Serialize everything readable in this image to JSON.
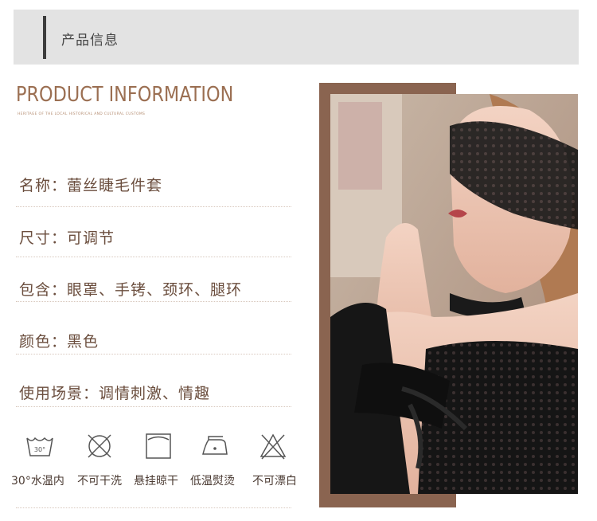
{
  "header": {
    "title": "产品信息"
  },
  "intro": {
    "title_en": "PRODUCT INFORMATION",
    "subtitle_en": "HERITAGE OF THE LOCAL HISTORICAL AND CULTURAL CUSTOMS"
  },
  "specs": [
    {
      "text": "名称：蕾丝睫毛件套"
    },
    {
      "text": "尺寸：可调节"
    },
    {
      "text": "包含：眼罩、手铐、颈环、腿环"
    },
    {
      "text": "颜色：黑色"
    },
    {
      "text": "使用场景：调情刺激、情趣"
    }
  ],
  "care": [
    {
      "icon": "wash-30-icon",
      "label": "30°水温内",
      "badge": "30°"
    },
    {
      "icon": "no-dry-clean-icon",
      "label": "不可干洗"
    },
    {
      "icon": "hang-dry-icon",
      "label": "悬挂晾干"
    },
    {
      "icon": "low-iron-icon",
      "label": "低温熨烫"
    },
    {
      "icon": "no-bleach-icon",
      "label": "不可漂白"
    }
  ],
  "colors": {
    "accent": "#9b6f52",
    "frame": "#8a6450",
    "header_bg": "#e3e3e3"
  }
}
